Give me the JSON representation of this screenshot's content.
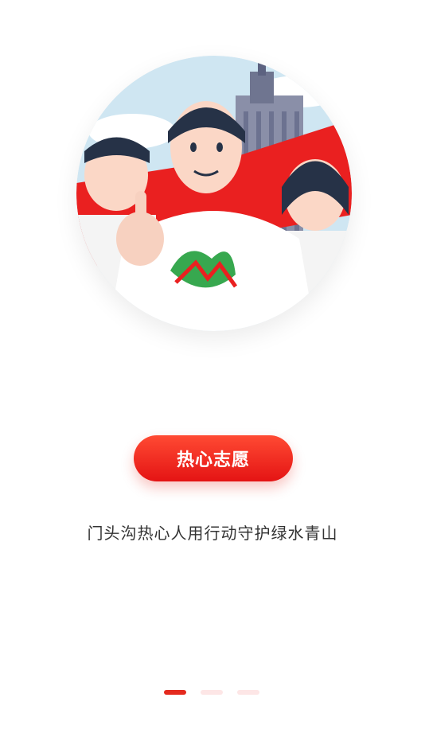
{
  "illustration": {
    "alt": "热心志愿"
  },
  "badge": {
    "label": "热心志愿",
    "color_start": "#ff4a33",
    "color_end": "#e41414"
  },
  "tagline": "门头沟热心人用行动守护绿水青山",
  "pager": {
    "count": 3,
    "active_index": 0,
    "active_color": "#e42a1e",
    "inactive_color": "#fde6e6"
  }
}
